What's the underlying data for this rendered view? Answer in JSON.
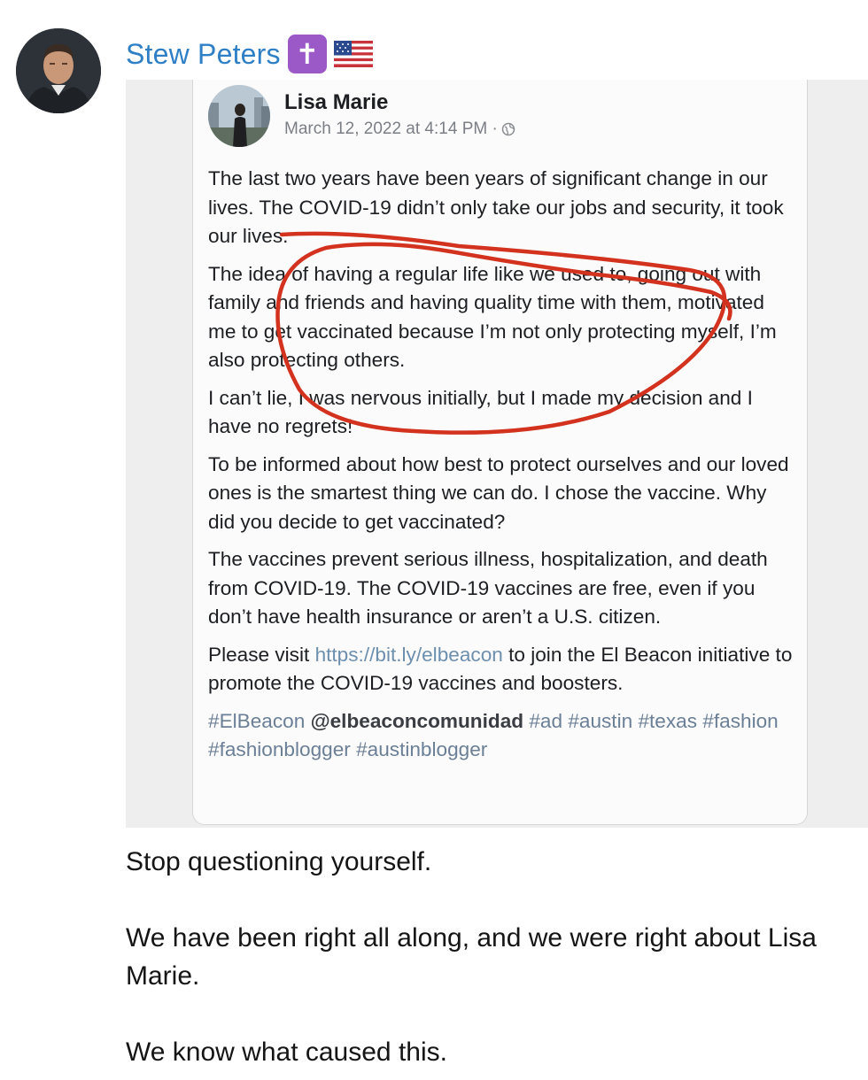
{
  "message": {
    "sender_name": "Stew Peters",
    "sender_badges": [
      "cross-emoji",
      "us-flag-emoji"
    ],
    "sender_name_color": "#2f7fc6",
    "caption_lines": [
      "Stop questioning yourself.",
      "We have been right all along, and we were right about Lisa Marie.",
      "We know what caused this."
    ]
  },
  "embedded_post": {
    "author": "Lisa Marie",
    "timestamp": "March 12, 2022 at 4:14 PM ·",
    "privacy_icon": "globe-icon",
    "paragraphs": [
      "The last two years have been years of significant change in our lives. The COVID-19 didn’t only take our jobs and security, it took our lives.",
      "The idea of having a regular life like we used to, going out with family and friends and having quality time with them, motivated me to get vaccinated because I’m not only protecting myself, I’m also protecting others.",
      "I can’t lie, I was nervous initially, but I made my decision and I have no regrets!",
      "To be informed about how best to protect ourselves and our loved ones is the smartest thing we can do. I chose the vaccine. Why did you decide to get vaccinated?",
      "The vaccines prevent serious illness, hospitalization, and death from COVID-19. The COVID-19 vaccines are free, even if you don’t have health insurance or aren’t a U.S. citizen."
    ],
    "visit_prefix": "Please visit ",
    "visit_link": "https://bit.ly/elbeacon",
    "visit_suffix": " to join the El Beacon initiative to promote the COVID-19 vaccines and boosters.",
    "hashtag_first": "#ElBeacon",
    "mention": "@elbeaconcomunidad",
    "hashtags_rest": "#ad #austin #texas #fashion #fashionblogger #austinblogger",
    "annotation_color": "#d2321e"
  }
}
